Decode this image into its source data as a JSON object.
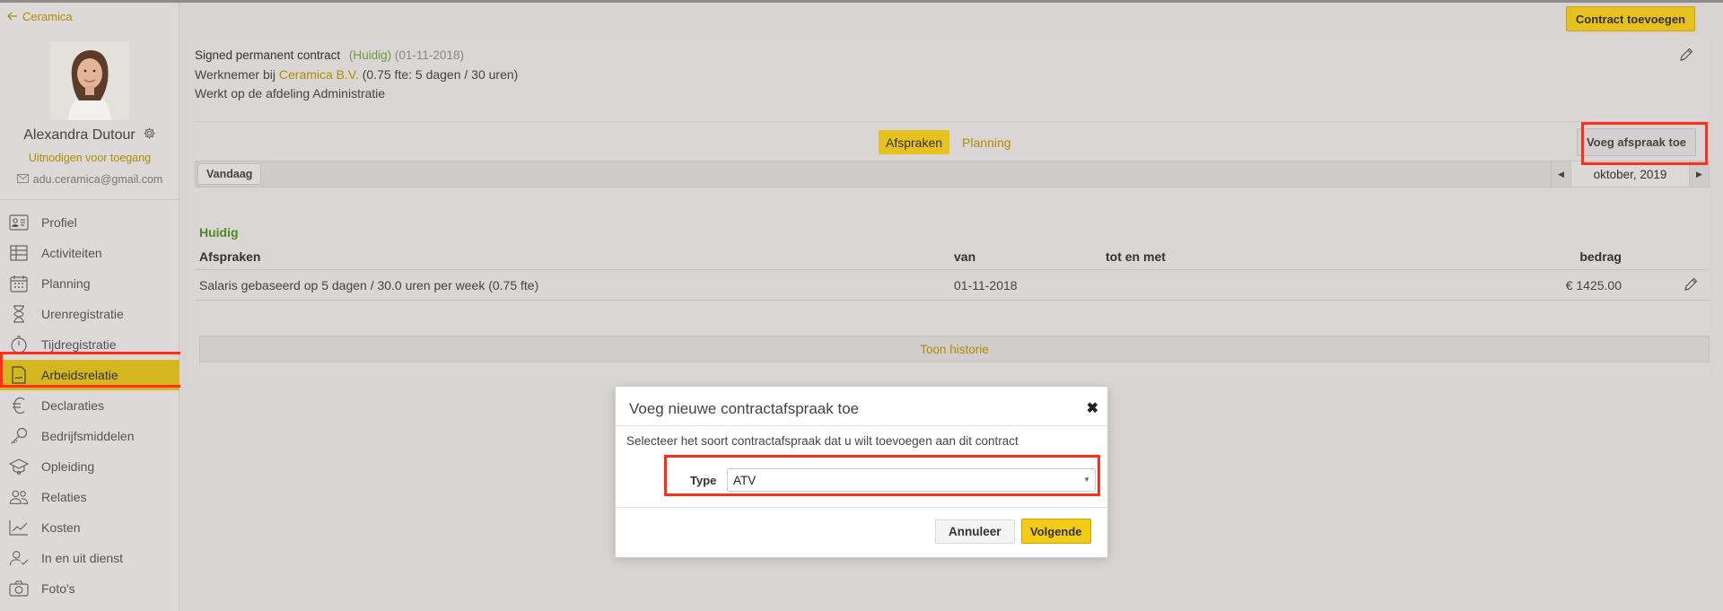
{
  "sidebar": {
    "back_label": "Ceramica",
    "user_name": "Alexandra Dutour",
    "invite_label": "Uitnodigen voor toegang",
    "email": "adu.ceramica@gmail.com",
    "items": [
      {
        "label": "Profiel",
        "icon": "id-card-icon"
      },
      {
        "label": "Activiteiten",
        "icon": "table-icon"
      },
      {
        "label": "Planning",
        "icon": "calendar-icon"
      },
      {
        "label": "Urenregistratie",
        "icon": "hourglass-icon"
      },
      {
        "label": "Tijdregistratie",
        "icon": "stopwatch-icon"
      },
      {
        "label": "Arbeidsrelatie",
        "icon": "contract-icon",
        "active": true
      },
      {
        "label": "Declaraties",
        "icon": "euro-icon"
      },
      {
        "label": "Bedrijfsmiddelen",
        "icon": "key-icon"
      },
      {
        "label": "Opleiding",
        "icon": "graduation-icon"
      },
      {
        "label": "Relaties",
        "icon": "people-icon"
      },
      {
        "label": "Kosten",
        "icon": "chart-icon"
      },
      {
        "label": "In en uit dienst",
        "icon": "user-check-icon"
      },
      {
        "label": "Foto's",
        "icon": "camera-icon"
      }
    ]
  },
  "main": {
    "add_contract_label": "Contract toevoegen",
    "contract": {
      "title": "Signed permanent contract",
      "status": "(Huidig)",
      "start_date": "(01-11-2018)",
      "employer_prefix": "Werknemer bij",
      "company": "Ceramica B.V.",
      "fte_info": "(0.75 fte: 5 dagen / 30 uren)",
      "department": "Werkt op de afdeling Administratie"
    },
    "tabs": [
      {
        "label": "Afspraken",
        "active": true
      },
      {
        "label": "Planning",
        "active": false
      }
    ],
    "add_agreement_label": "Voeg afspraak toe",
    "today_label": "Vandaag",
    "month_label": "oktober, 2019",
    "section_label": "Huidig",
    "table": {
      "headers": [
        "Afspraken",
        "van",
        "tot en met",
        "bedrag"
      ],
      "rows": [
        {
          "description": "Salaris gebaseerd op 5 dagen / 30.0 uren per week (0.75 fte)",
          "from": "01-11-2018",
          "to": "",
          "amount": "€ 1425.00"
        }
      ]
    },
    "history_label": "Toon historie"
  },
  "modal": {
    "title": "Voeg nieuwe contractafspraak toe",
    "close_glyph": "✖",
    "description": "Selecteer het soort contractafspraak dat u wilt toevoegen aan dit contract",
    "type_label": "Type",
    "type_value": "ATV",
    "cancel_label": "Annuleer",
    "next_label": "Volgende"
  },
  "colors": {
    "accent": "#e7c21f",
    "link": "#b08d00",
    "status_green": "#4d8a1f",
    "highlight": "#ff2d1a"
  }
}
